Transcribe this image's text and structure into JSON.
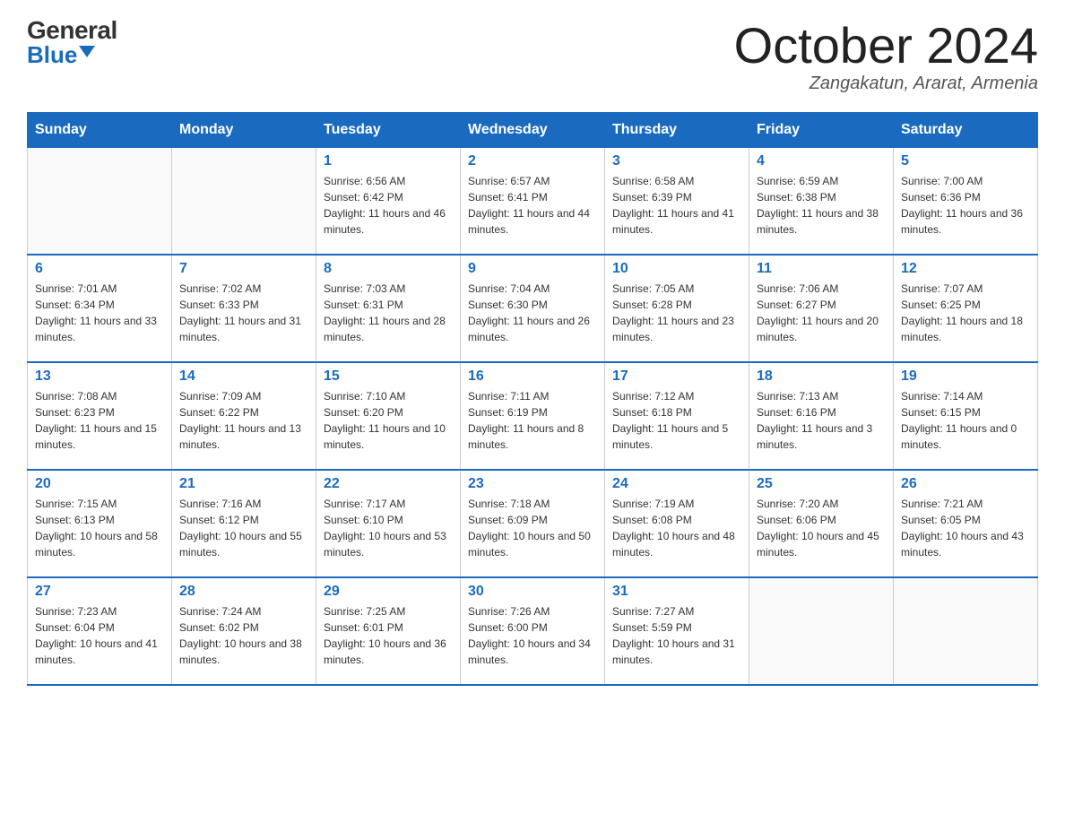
{
  "header": {
    "logo_general": "General",
    "logo_blue": "Blue",
    "month_title": "October 2024",
    "location": "Zangakatun, Ararat, Armenia"
  },
  "days_of_week": [
    "Sunday",
    "Monday",
    "Tuesday",
    "Wednesday",
    "Thursday",
    "Friday",
    "Saturday"
  ],
  "weeks": [
    [
      {
        "day": "",
        "sunrise": "",
        "sunset": "",
        "daylight": ""
      },
      {
        "day": "",
        "sunrise": "",
        "sunset": "",
        "daylight": ""
      },
      {
        "day": "1",
        "sunrise": "Sunrise: 6:56 AM",
        "sunset": "Sunset: 6:42 PM",
        "daylight": "Daylight: 11 hours and 46 minutes."
      },
      {
        "day": "2",
        "sunrise": "Sunrise: 6:57 AM",
        "sunset": "Sunset: 6:41 PM",
        "daylight": "Daylight: 11 hours and 44 minutes."
      },
      {
        "day": "3",
        "sunrise": "Sunrise: 6:58 AM",
        "sunset": "Sunset: 6:39 PM",
        "daylight": "Daylight: 11 hours and 41 minutes."
      },
      {
        "day": "4",
        "sunrise": "Sunrise: 6:59 AM",
        "sunset": "Sunset: 6:38 PM",
        "daylight": "Daylight: 11 hours and 38 minutes."
      },
      {
        "day": "5",
        "sunrise": "Sunrise: 7:00 AM",
        "sunset": "Sunset: 6:36 PM",
        "daylight": "Daylight: 11 hours and 36 minutes."
      }
    ],
    [
      {
        "day": "6",
        "sunrise": "Sunrise: 7:01 AM",
        "sunset": "Sunset: 6:34 PM",
        "daylight": "Daylight: 11 hours and 33 minutes."
      },
      {
        "day": "7",
        "sunrise": "Sunrise: 7:02 AM",
        "sunset": "Sunset: 6:33 PM",
        "daylight": "Daylight: 11 hours and 31 minutes."
      },
      {
        "day": "8",
        "sunrise": "Sunrise: 7:03 AM",
        "sunset": "Sunset: 6:31 PM",
        "daylight": "Daylight: 11 hours and 28 minutes."
      },
      {
        "day": "9",
        "sunrise": "Sunrise: 7:04 AM",
        "sunset": "Sunset: 6:30 PM",
        "daylight": "Daylight: 11 hours and 26 minutes."
      },
      {
        "day": "10",
        "sunrise": "Sunrise: 7:05 AM",
        "sunset": "Sunset: 6:28 PM",
        "daylight": "Daylight: 11 hours and 23 minutes."
      },
      {
        "day": "11",
        "sunrise": "Sunrise: 7:06 AM",
        "sunset": "Sunset: 6:27 PM",
        "daylight": "Daylight: 11 hours and 20 minutes."
      },
      {
        "day": "12",
        "sunrise": "Sunrise: 7:07 AM",
        "sunset": "Sunset: 6:25 PM",
        "daylight": "Daylight: 11 hours and 18 minutes."
      }
    ],
    [
      {
        "day": "13",
        "sunrise": "Sunrise: 7:08 AM",
        "sunset": "Sunset: 6:23 PM",
        "daylight": "Daylight: 11 hours and 15 minutes."
      },
      {
        "day": "14",
        "sunrise": "Sunrise: 7:09 AM",
        "sunset": "Sunset: 6:22 PM",
        "daylight": "Daylight: 11 hours and 13 minutes."
      },
      {
        "day": "15",
        "sunrise": "Sunrise: 7:10 AM",
        "sunset": "Sunset: 6:20 PM",
        "daylight": "Daylight: 11 hours and 10 minutes."
      },
      {
        "day": "16",
        "sunrise": "Sunrise: 7:11 AM",
        "sunset": "Sunset: 6:19 PM",
        "daylight": "Daylight: 11 hours and 8 minutes."
      },
      {
        "day": "17",
        "sunrise": "Sunrise: 7:12 AM",
        "sunset": "Sunset: 6:18 PM",
        "daylight": "Daylight: 11 hours and 5 minutes."
      },
      {
        "day": "18",
        "sunrise": "Sunrise: 7:13 AM",
        "sunset": "Sunset: 6:16 PM",
        "daylight": "Daylight: 11 hours and 3 minutes."
      },
      {
        "day": "19",
        "sunrise": "Sunrise: 7:14 AM",
        "sunset": "Sunset: 6:15 PM",
        "daylight": "Daylight: 11 hours and 0 minutes."
      }
    ],
    [
      {
        "day": "20",
        "sunrise": "Sunrise: 7:15 AM",
        "sunset": "Sunset: 6:13 PM",
        "daylight": "Daylight: 10 hours and 58 minutes."
      },
      {
        "day": "21",
        "sunrise": "Sunrise: 7:16 AM",
        "sunset": "Sunset: 6:12 PM",
        "daylight": "Daylight: 10 hours and 55 minutes."
      },
      {
        "day": "22",
        "sunrise": "Sunrise: 7:17 AM",
        "sunset": "Sunset: 6:10 PM",
        "daylight": "Daylight: 10 hours and 53 minutes."
      },
      {
        "day": "23",
        "sunrise": "Sunrise: 7:18 AM",
        "sunset": "Sunset: 6:09 PM",
        "daylight": "Daylight: 10 hours and 50 minutes."
      },
      {
        "day": "24",
        "sunrise": "Sunrise: 7:19 AM",
        "sunset": "Sunset: 6:08 PM",
        "daylight": "Daylight: 10 hours and 48 minutes."
      },
      {
        "day": "25",
        "sunrise": "Sunrise: 7:20 AM",
        "sunset": "Sunset: 6:06 PM",
        "daylight": "Daylight: 10 hours and 45 minutes."
      },
      {
        "day": "26",
        "sunrise": "Sunrise: 7:21 AM",
        "sunset": "Sunset: 6:05 PM",
        "daylight": "Daylight: 10 hours and 43 minutes."
      }
    ],
    [
      {
        "day": "27",
        "sunrise": "Sunrise: 7:23 AM",
        "sunset": "Sunset: 6:04 PM",
        "daylight": "Daylight: 10 hours and 41 minutes."
      },
      {
        "day": "28",
        "sunrise": "Sunrise: 7:24 AM",
        "sunset": "Sunset: 6:02 PM",
        "daylight": "Daylight: 10 hours and 38 minutes."
      },
      {
        "day": "29",
        "sunrise": "Sunrise: 7:25 AM",
        "sunset": "Sunset: 6:01 PM",
        "daylight": "Daylight: 10 hours and 36 minutes."
      },
      {
        "day": "30",
        "sunrise": "Sunrise: 7:26 AM",
        "sunset": "Sunset: 6:00 PM",
        "daylight": "Daylight: 10 hours and 34 minutes."
      },
      {
        "day": "31",
        "sunrise": "Sunrise: 7:27 AM",
        "sunset": "Sunset: 5:59 PM",
        "daylight": "Daylight: 10 hours and 31 minutes."
      },
      {
        "day": "",
        "sunrise": "",
        "sunset": "",
        "daylight": ""
      },
      {
        "day": "",
        "sunrise": "",
        "sunset": "",
        "daylight": ""
      }
    ]
  ]
}
